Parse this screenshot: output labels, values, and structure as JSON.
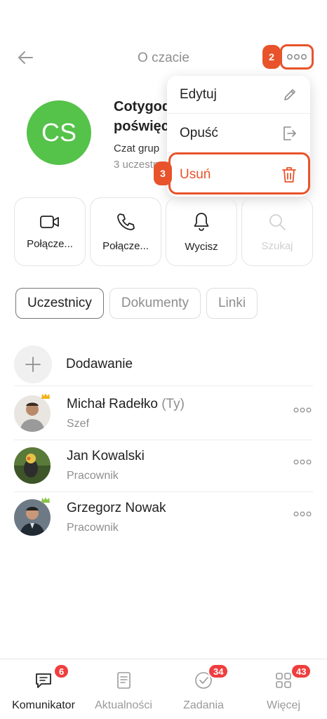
{
  "header": {
    "title": "O czacie"
  },
  "steps": {
    "more": "2",
    "delete": "3"
  },
  "chat": {
    "initials": "CS",
    "avatar_color": "#55c24a",
    "name_line1": "Cotygodn",
    "name_line2": "poświęco",
    "type": "Czat grup",
    "members_count": "3 uczestn"
  },
  "menu": {
    "edit": "Edytuj",
    "leave": "Opuść",
    "delete": "Usuń"
  },
  "actions": [
    {
      "label": "Połącze...",
      "icon": "video-icon"
    },
    {
      "label": "Połącze...",
      "icon": "phone-icon"
    },
    {
      "label": "Wycisz",
      "icon": "bell-icon"
    },
    {
      "label": "Szukaj",
      "icon": "search-icon"
    }
  ],
  "tabs": [
    "Uczestnicy",
    "Dokumenty",
    "Linki"
  ],
  "add_label": "Dodawanie",
  "members": [
    {
      "name": "Michał Radełko",
      "suffix": "(Ty)",
      "role": "Szef"
    },
    {
      "name": "Jan Kowalski",
      "suffix": "",
      "role": "Pracownik"
    },
    {
      "name": "Grzegorz Nowak",
      "suffix": "",
      "role": "Pracownik"
    }
  ],
  "tabbar": [
    {
      "label": "Komunikator",
      "badge": "6"
    },
    {
      "label": "Aktualności",
      "badge": ""
    },
    {
      "label": "Zadania",
      "badge": "34"
    },
    {
      "label": "Więcej",
      "badge": "43"
    }
  ],
  "colors": {
    "accent": "#e8532b",
    "badge": "#ef3e3e",
    "crown_gold": "#f2b21b",
    "crown_green": "#8bc34a"
  }
}
